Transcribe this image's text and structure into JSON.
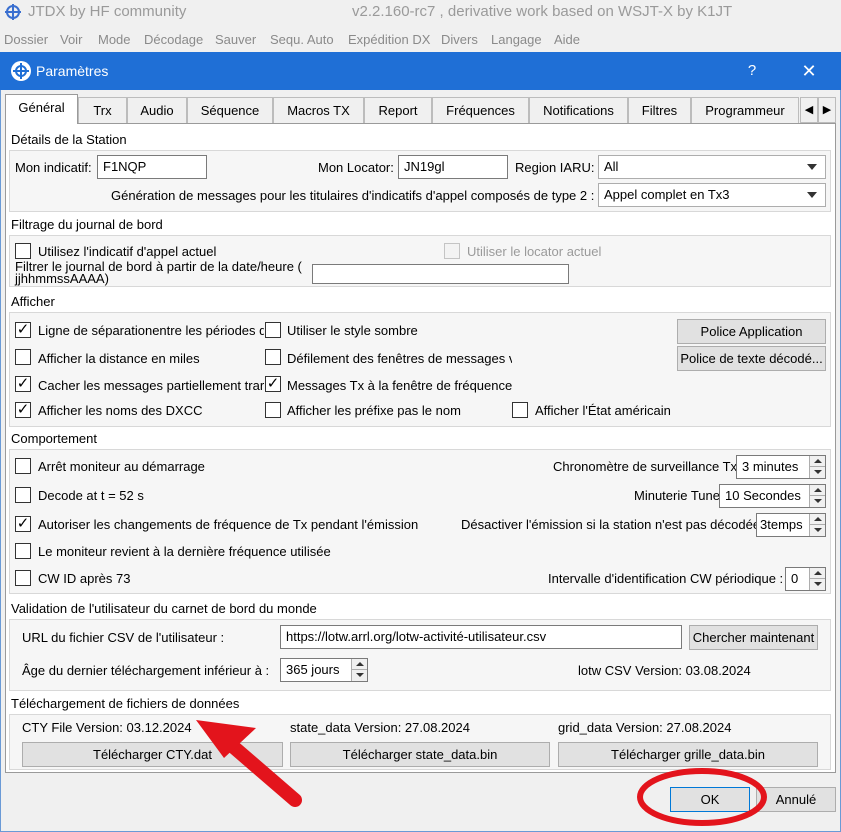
{
  "app": {
    "title_left": "JTDX  by HF community",
    "title_right": "v2.2.160-rc7 , derivative work based on WSJT-X by K1JT",
    "menu": [
      "Dossier",
      "Voir",
      "Mode",
      "Décodage",
      "Sauver",
      "Sequ. Auto",
      "Expédition DX",
      "Divers",
      "Langage",
      "Aide"
    ]
  },
  "dialog": {
    "title": "Paramètres",
    "help": "?",
    "close": "✕",
    "tabs": [
      "Général",
      "Trx",
      "Audio",
      "Séquence",
      "Macros TX",
      "Report",
      "Fréquences",
      "Notifications",
      "Filtres",
      "Programmeur"
    ],
    "active_tab": "Général"
  },
  "station": {
    "section": "Détails de la Station",
    "callsign_label": "Mon indicatif:",
    "callsign": "F1NQP",
    "locator_label": "Mon Locator:",
    "locator": "JN19gl",
    "iaru_label": "Region IARU:",
    "iaru": "All",
    "type2_label": "Génération de messages pour les titulaires d'indicatifs d'appel composés de type 2 :",
    "type2": "Appel complet en Tx3"
  },
  "logfilter": {
    "section": "Filtrage du journal de bord",
    "use_current_call": "Utilisez l'indicatif d'appel actuel",
    "use_current_locator": "Utiliser le locator actuel",
    "filter_date_l1": "Filtrer le journal de bord à partir de la date/heure (",
    "filter_date_l2": "jjhhmmssAAAA)"
  },
  "display": {
    "section": "Afficher",
    "items": {
      "separator": "Ligne de séparationentre les périodes d",
      "dark_style": "Utiliser le style sombre",
      "miles": "Afficher la distance en miles",
      "scroll": "Défilement des fenêtres de messages v",
      "hide_partial": "Cacher les messages partiellement trar",
      "tx_messages": "Messages Tx à la fenêtre de fréquence",
      "dxcc_names": "Afficher les noms des DXCC",
      "prefix": "Afficher les préfixe pas le nom",
      "us_state": "Afficher l'État américain"
    },
    "font_app": "Police Application",
    "font_decoded": "Police de texte décodé..."
  },
  "behavior": {
    "section": "Comportement",
    "stop_monitor": "Arrêt moniteur au démarrage",
    "decode_52": "Decode at t = 52 s",
    "allow_freq": "Autoriser les changements de fréquence de Tx pendant l'émission",
    "monitor_return": "Le moniteur revient à la dernière fréquence utilisée",
    "cwid": "CW ID après 73",
    "watchdog_label": "Chronomètre de surveillance Tx",
    "watchdog": "3 minutes",
    "tune_label": "Minuterie Tune",
    "tune": "10 Secondes",
    "disable_label": "Désactiver l'émission si la station n'est pas décodée",
    "disable": "3temps",
    "cw_interval_label": "Intervalle d'identification CW périodique :",
    "cw_interval": "0"
  },
  "lotw": {
    "section": "Validation de l'utilisateur du carnet de bord du monde",
    "url_label": "URL du fichier CSV de l'utilisateur :",
    "url": "https://lotw.arrl.org/lotw-activité-utilisateur.csv",
    "fetch": "Chercher maintenant",
    "age_label": "Âge du dernier téléchargement inférieur à :",
    "age": "365 jours",
    "version": "lotw CSV Version: 03.08.2024"
  },
  "datafiles": {
    "section": "Téléchargement de fichiers de données",
    "cty_version": "CTY File Version: 03.12.2024",
    "state_version": "state_data Version: 27.08.2024",
    "grid_version": "grid_data Version: 27.08.2024",
    "dl_cty": "Télécharger CTY.dat",
    "dl_state": "Télécharger state_data.bin",
    "dl_grid": "Télécharger grille_data.bin"
  },
  "buttons": {
    "ok": "OK",
    "cancel": "Annulé"
  },
  "checks": "✓",
  "colors": {
    "title_blue": "#1f6fd6",
    "annotation_red": "#e3141c"
  }
}
